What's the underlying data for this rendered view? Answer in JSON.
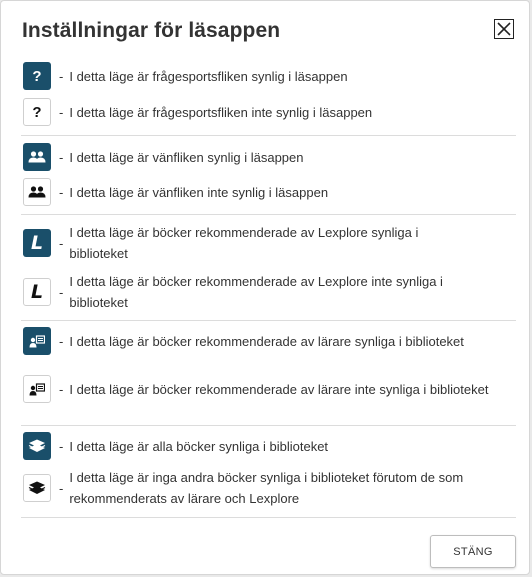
{
  "dialog": {
    "title": "Inställningar för läsappen",
    "close_button_label": "STÄNG"
  },
  "items": [
    {
      "icon": "question-icon",
      "style": "dark",
      "dash": "-",
      "text": "I detta läge är frågesportsfliken synlig i läsappen"
    },
    {
      "icon": "question-icon",
      "style": "light",
      "dash": "-",
      "text": "I detta läge är frågesportsfliken inte synlig i läsappen"
    },
    {
      "icon": "friends-icon",
      "style": "dark",
      "dash": "-",
      "text": "I detta läge är vänfliken synlig i läsappen"
    },
    {
      "icon": "friends-icon",
      "style": "light",
      "dash": "-",
      "text": "I detta läge är vänfliken inte synlig i läsappen"
    },
    {
      "icon": "lexplore-icon",
      "style": "dark",
      "dash": "-",
      "text": "I detta läge är böcker rekommenderade av Lexplore synliga i biblioteket"
    },
    {
      "icon": "lexplore-icon",
      "style": "light",
      "dash": "-",
      "text": "I detta läge är böcker rekommenderade av Lexplore inte synliga i biblioteket"
    },
    {
      "icon": "teacher-icon",
      "style": "dark",
      "dash": "-",
      "text": "I detta läge är böcker rekommenderade av lärare synliga i biblioteket"
    },
    {
      "icon": "teacher-icon",
      "style": "light",
      "dash": "-",
      "text": "I detta läge är böcker rekommenderade av lärare inte synliga i biblioteket"
    },
    {
      "icon": "books-icon",
      "style": "dark",
      "dash": "-",
      "text": "I detta läge är alla böcker synliga i biblioteket"
    },
    {
      "icon": "books-icon",
      "style": "light",
      "dash": "-",
      "text": "I detta läge är inga andra böcker synliga i biblioteket förutom de som rekommenderats av lärare och Lexplore"
    }
  ],
  "colors": {
    "icon_dark_bg": "#1a4f6a"
  }
}
